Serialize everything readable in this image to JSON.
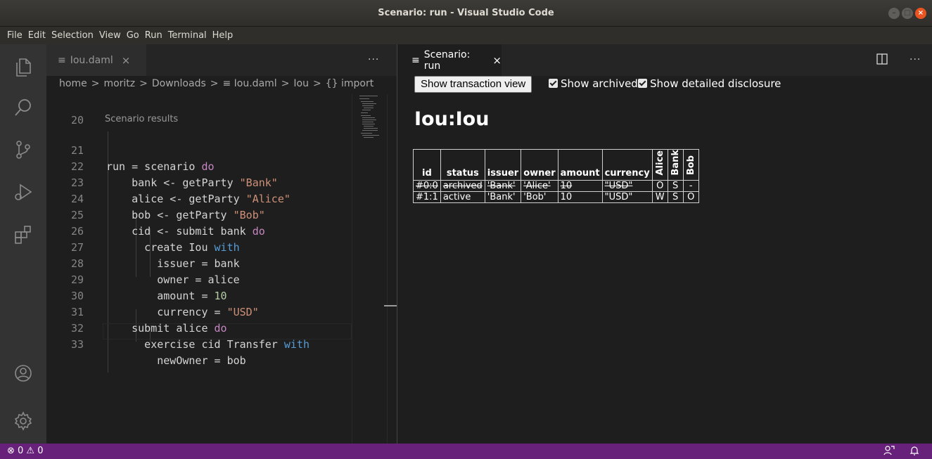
{
  "window": {
    "title": "Scenario: run - Visual Studio Code",
    "minimize": "–",
    "maximize": "□",
    "close": "×"
  },
  "menu": [
    "File",
    "Edit",
    "Selection",
    "View",
    "Go",
    "Run",
    "Terminal",
    "Help"
  ],
  "left_editor": {
    "tab": {
      "icon": "≡",
      "label": "Iou.daml",
      "close": "×"
    },
    "more": "···",
    "breadcrumb": [
      "home",
      ">",
      "moritz",
      ">",
      "Downloads",
      ">",
      "≡ Iou.daml",
      ">",
      "Iou",
      ">",
      "{} import"
    ],
    "code_lens": "Scenario results",
    "lines": [
      {
        "n": "20",
        "text": ""
      },
      {
        "n": "21",
        "text": "run = scenario do"
      },
      {
        "n": "22",
        "text": "    bank <- getParty \"Bank\""
      },
      {
        "n": "23",
        "text": "    alice <- getParty \"Alice\""
      },
      {
        "n": "24",
        "text": "    bob <- getParty \"Bob\""
      },
      {
        "n": "25",
        "text": "    cid <- submit bank do"
      },
      {
        "n": "26",
        "text": "      create Iou with"
      },
      {
        "n": "27",
        "text": "        issuer = bank"
      },
      {
        "n": "28",
        "text": "        owner = alice"
      },
      {
        "n": "29",
        "text": "        amount = 10"
      },
      {
        "n": "30",
        "text": "        currency = \"USD\""
      },
      {
        "n": "31",
        "text": "    submit alice do"
      },
      {
        "n": "32",
        "text": "      exercise cid Transfer with"
      },
      {
        "n": "33",
        "text": "        newOwner = bob"
      }
    ]
  },
  "right_editor": {
    "tab": {
      "icon": "≡",
      "label": "Scenario: run",
      "close": "×"
    },
    "more": "···",
    "button": "Show transaction view",
    "show_archived": "Show archived",
    "show_disclosure": "Show detailed disclosure",
    "template_name": "Iou:Iou",
    "table": {
      "headers": [
        "id",
        "status",
        "issuer",
        "owner",
        "amount",
        "currency"
      ],
      "parties": [
        "Alice",
        "Bank",
        "Bob"
      ],
      "rows": [
        {
          "id": "#0:0",
          "status": "archived",
          "issuer": "'Bank'",
          "owner": "'Alice'",
          "amount": "10",
          "currency": "\"USD\"",
          "alice": "O",
          "bank": "S",
          "bob": "-"
        },
        {
          "id": "#1:1",
          "status": "active",
          "issuer": "'Bank'",
          "owner": "'Bob'",
          "amount": "10",
          "currency": "\"USD\"",
          "alice": "W",
          "bank": "S",
          "bob": "O"
        }
      ]
    }
  },
  "statusbar": {
    "problems": "⊗ 0 ⚠ 0"
  },
  "colors": {
    "statusbar": "#68217a",
    "keyword": "#c586c0",
    "string": "#ce9178",
    "number": "#b5cea8"
  }
}
